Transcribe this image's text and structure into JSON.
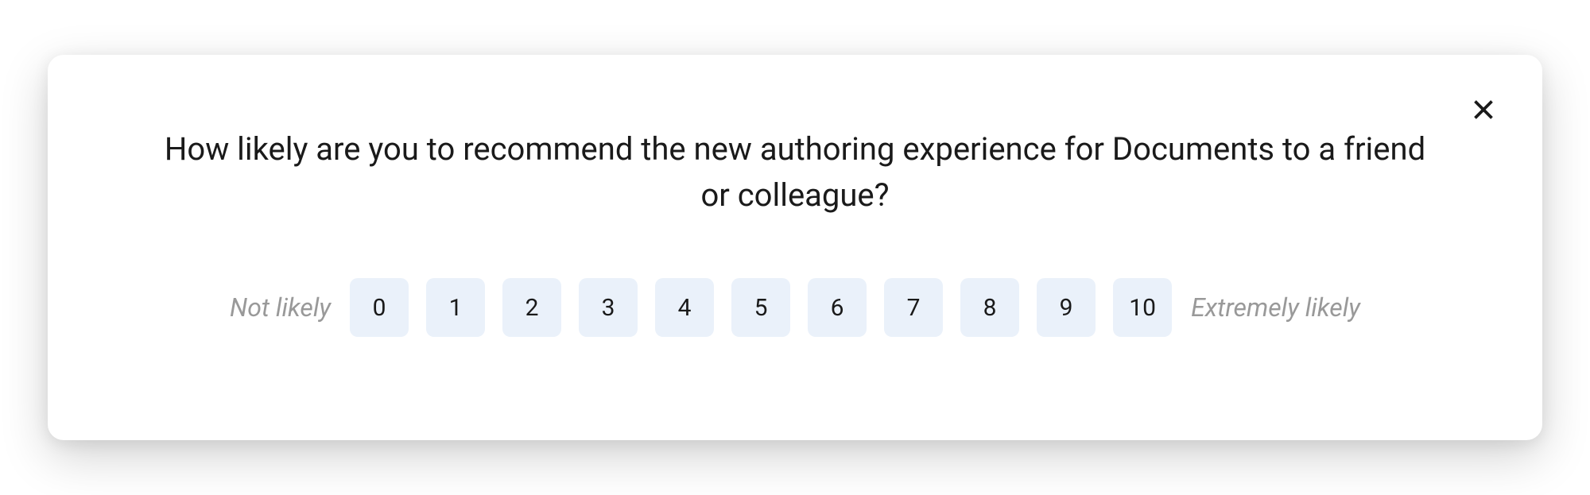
{
  "modal": {
    "question": "How likely are you to recommend the new authoring experience for Documents to a friend or colleague?",
    "scale": {
      "low_label": "Not likely",
      "high_label": "Extremely likely",
      "options": [
        "0",
        "1",
        "2",
        "3",
        "4",
        "5",
        "6",
        "7",
        "8",
        "9",
        "10"
      ]
    }
  }
}
